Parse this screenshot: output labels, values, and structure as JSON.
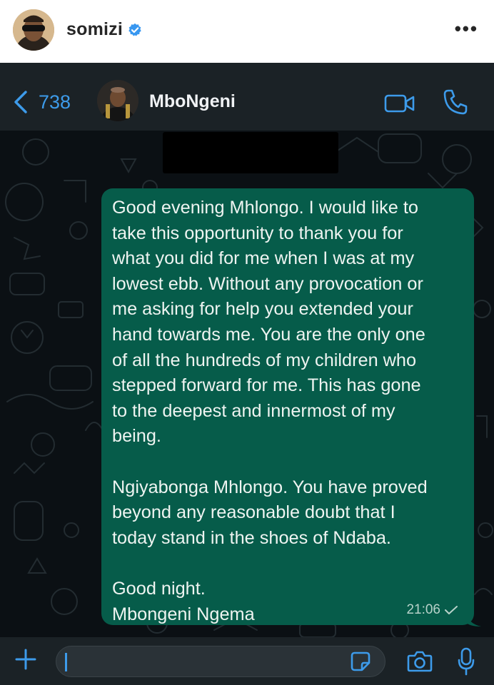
{
  "post_header": {
    "username": "somizi",
    "verified_icon": "verified-badge-icon",
    "more_icon": "more-options-icon"
  },
  "chat": {
    "back_count": "738",
    "contact_name": "MboNgeni",
    "icons": [
      "back-chevron-icon",
      "video-call-icon",
      "phone-icon"
    ],
    "message": {
      "paragraphs": [
        "Good evening Mhlongo. I would like to\ntake this opportunity to thank you for\nwhat you did for me when I was at my\nlowest ebb. Without any provocation or\nme asking for help you extended your\nhand towards me. You are the only one\nof all the hundreds of my children who\nstepped forward for me. This has gone\nto the deepest and innermost of my\nbeing.",
        "Ngiyabonga Mhlongo. You have proved\nbeyond any reasonable doubt that I\ntoday stand in the shoes of Ndaba.",
        "Good night.\nMbongeni Ngema"
      ],
      "time": "21:06",
      "status_icon": "sent-check-icon"
    },
    "composer": {
      "icons": [
        "plus-icon",
        "sticker-icon",
        "camera-icon",
        "microphone-icon"
      ]
    }
  },
  "colors": {
    "bubble": "#065c4a",
    "chat_background": "#0b1014",
    "bar_background": "#1b2226",
    "accent_blue": "#3d9bea",
    "verified_blue": "#3897f0"
  }
}
